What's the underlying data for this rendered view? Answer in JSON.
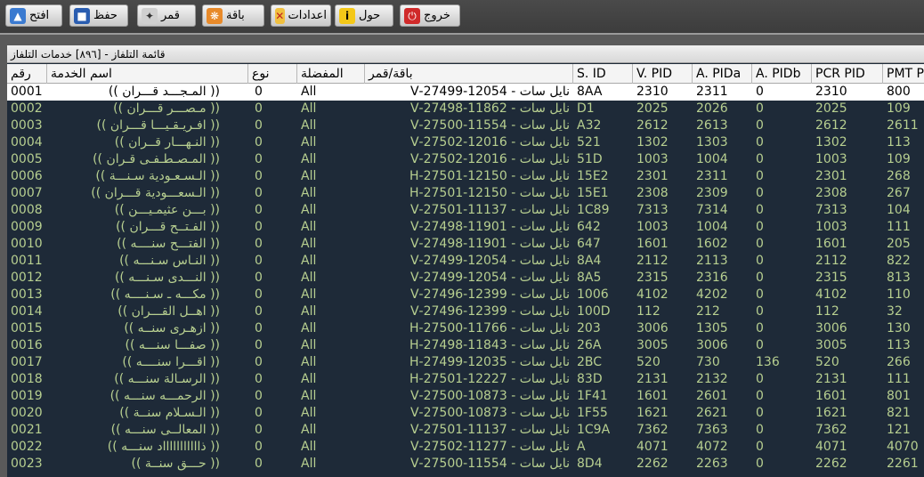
{
  "toolbar": {
    "open": "افتح",
    "save": "حفظ",
    "satellite": "قمر",
    "bouquet": "باقة",
    "settings": "اعدادات",
    "about": "حول",
    "exit": "خروج"
  },
  "panel": {
    "caption": "قائمة التلفاز - [٨٩٦] خدمات التلفاز"
  },
  "columns": {
    "num": "رقم",
    "name": "اسم الخدمة",
    "type": "نوع",
    "fav": "المفضلة",
    "sat": "باقة/قمر",
    "sid": "S. ID",
    "vpid": "V. PID",
    "apida": "A. PIDa",
    "apidb": "A. PIDb",
    "pcr": "PCR PID",
    "pmt": "PMT P"
  },
  "rows": [
    {
      "num": "0001",
      "name": "(( المـجـــد قـــران ))",
      "type": "0",
      "fav": "All",
      "sat": "نايل سات - 12054-27499-V",
      "sid": "8AA",
      "vpid": "2310",
      "apida": "2311",
      "apidb": "0",
      "pcr": "2310",
      "pmt": "800"
    },
    {
      "num": "0002",
      "name": "(( مـصـــر قـــران ))",
      "type": "0",
      "fav": "All",
      "sat": "نايل سات - 11862-27498-V",
      "sid": "D1",
      "vpid": "2025",
      "apida": "2026",
      "apidb": "0",
      "pcr": "2025",
      "pmt": "109"
    },
    {
      "num": "0003",
      "name": "(( افـريـقـيـــا قـــران ))",
      "type": "0",
      "fav": "All",
      "sat": "نايل سات - 11554-27500-V",
      "sid": "A32",
      "vpid": "2612",
      "apida": "2613",
      "apidb": "0",
      "pcr": "2612",
      "pmt": "2611"
    },
    {
      "num": "0004",
      "name": "(( النـهـــار قــران ))",
      "type": "0",
      "fav": "All",
      "sat": "نايل سات - 12016-27502-V",
      "sid": "521",
      "vpid": "1302",
      "apida": "1303",
      "apidb": "0",
      "pcr": "1302",
      "pmt": "113"
    },
    {
      "num": "0005",
      "name": "(( المـصـطـفـى قـران ))",
      "type": "0",
      "fav": "All",
      "sat": "نايل سات - 12016-27502-V",
      "sid": "51D",
      "vpid": "1003",
      "apida": "1004",
      "apidb": "0",
      "pcr": "1003",
      "pmt": "109"
    },
    {
      "num": "0006",
      "name": "(( الـسـعـودية سـنـــة ))",
      "type": "0",
      "fav": "All",
      "sat": "نايل سات - 12150-27501-H",
      "sid": "15E2",
      "vpid": "2301",
      "apida": "2311",
      "apidb": "0",
      "pcr": "2301",
      "pmt": "268"
    },
    {
      "num": "0007",
      "name": "(( الـسعـــودية قـــران ))",
      "type": "0",
      "fav": "All",
      "sat": "نايل سات - 12150-27501-H",
      "sid": "15E1",
      "vpid": "2308",
      "apida": "2309",
      "apidb": "0",
      "pcr": "2308",
      "pmt": "267"
    },
    {
      "num": "0008",
      "name": "(( بـــن عثيمـيـــن ))",
      "type": "0",
      "fav": "All",
      "sat": "نايل سات - 11137-27501-V",
      "sid": "1C89",
      "vpid": "7313",
      "apida": "7314",
      "apidb": "0",
      "pcr": "7313",
      "pmt": "104"
    },
    {
      "num": "0009",
      "name": "(( الفـتــح قـــران ))",
      "type": "0",
      "fav": "All",
      "sat": "نايل سات - 11901-27498-V",
      "sid": "642",
      "vpid": "1003",
      "apida": "1004",
      "apidb": "0",
      "pcr": "1003",
      "pmt": "111"
    },
    {
      "num": "0010",
      "name": "(( الفتـــح سنــــه ))",
      "type": "0",
      "fav": "All",
      "sat": "نايل سات - 11901-27498-V",
      "sid": "647",
      "vpid": "1601",
      "apida": "1602",
      "apidb": "0",
      "pcr": "1601",
      "pmt": "205"
    },
    {
      "num": "0011",
      "name": "(( النـاس سـنـــه ))",
      "type": "0",
      "fav": "All",
      "sat": "نايل سات - 12054-27499-V",
      "sid": "8A4",
      "vpid": "2112",
      "apida": "2113",
      "apidb": "0",
      "pcr": "2112",
      "pmt": "822"
    },
    {
      "num": "0012",
      "name": "(( النـــدى سـنـــه ))",
      "type": "0",
      "fav": "All",
      "sat": "نايل سات - 12054-27499-V",
      "sid": "8A5",
      "vpid": "2315",
      "apida": "2316",
      "apidb": "0",
      "pcr": "2315",
      "pmt": "813"
    },
    {
      "num": "0013",
      "name": "(( مكـــه ـ سـنــــه ))",
      "type": "0",
      "fav": "All",
      "sat": "نايل سات - 12399-27496-V",
      "sid": "1006",
      "vpid": "4102",
      "apida": "4202",
      "apidb": "0",
      "pcr": "4102",
      "pmt": "110"
    },
    {
      "num": "0014",
      "name": "(( اهــل القـــران ))",
      "type": "0",
      "fav": "All",
      "sat": "نايل سات - 12399-27496-V",
      "sid": "100D",
      "vpid": "112",
      "apida": "212",
      "apidb": "0",
      "pcr": "112",
      "pmt": "32"
    },
    {
      "num": "0015",
      "name": "(( ازهـرى سنــه ))",
      "type": "0",
      "fav": "All",
      "sat": "نايل سات - 11766-27500-H",
      "sid": "203",
      "vpid": "3006",
      "apida": "1305",
      "apidb": "0",
      "pcr": "3006",
      "pmt": "130"
    },
    {
      "num": "0016",
      "name": "(( صفـــا سنـــه ))",
      "type": "0",
      "fav": "All",
      "sat": "نايل سات - 11843-27498-H",
      "sid": "26A",
      "vpid": "3005",
      "apida": "3006",
      "apidb": "0",
      "pcr": "3005",
      "pmt": "113"
    },
    {
      "num": "0017",
      "name": "(( اقـــرا سنــــه ))",
      "type": "0",
      "fav": "All",
      "sat": "نايل سات - 12035-27499-H",
      "sid": "2BC",
      "vpid": "520",
      "apida": "730",
      "apidb": "136",
      "pcr": "520",
      "pmt": "266"
    },
    {
      "num": "0018",
      "name": "(( الرسـالة سنـــه ))",
      "type": "0",
      "fav": "All",
      "sat": "نايل سات - 12227-27501-H",
      "sid": "83D",
      "vpid": "2131",
      "apida": "2132",
      "apidb": "0",
      "pcr": "2131",
      "pmt": "111"
    },
    {
      "num": "0019",
      "name": "(( الرحمـــه سنـــه ))",
      "type": "0",
      "fav": "All",
      "sat": "نايل سات - 10873-27500-V",
      "sid": "1F41",
      "vpid": "1601",
      "apida": "2601",
      "apidb": "0",
      "pcr": "1601",
      "pmt": "801"
    },
    {
      "num": "0020",
      "name": "(( الـسـلام سنــة ))",
      "type": "0",
      "fav": "All",
      "sat": "نايل سات - 10873-27500-V",
      "sid": "1F55",
      "vpid": "1621",
      "apida": "2621",
      "apidb": "0",
      "pcr": "1621",
      "pmt": "821"
    },
    {
      "num": "0021",
      "name": "(( المعالــى سنـــه ))",
      "type": "0",
      "fav": "All",
      "sat": "نايل سات - 11137-27501-V",
      "sid": "1C9A",
      "vpid": "7362",
      "apida": "7363",
      "apidb": "0",
      "pcr": "7362",
      "pmt": "121"
    },
    {
      "num": "0022",
      "name": "(( ذاااااااااااد سنـــه ))",
      "type": "0",
      "fav": "All",
      "sat": "نايل سات - 11277-27502-V",
      "sid": "A",
      "vpid": "4071",
      "apida": "4072",
      "apidb": "0",
      "pcr": "4071",
      "pmt": "4070"
    },
    {
      "num": "0023",
      "name": "(( حـــق سنــة ))",
      "type": "0",
      "fav": "All",
      "sat": "نايل سات - 11554-27500-V",
      "sid": "8D4",
      "vpid": "2262",
      "apida": "2263",
      "apidb": "0",
      "pcr": "2262",
      "pmt": "2261"
    }
  ]
}
